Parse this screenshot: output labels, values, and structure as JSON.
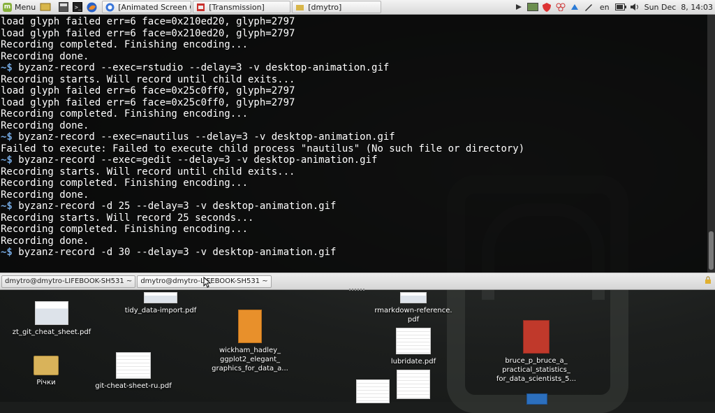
{
  "top_panel": {
    "menu_label": "Menu",
    "windows": [
      {
        "title": "[Animated Screen Ca..."
      },
      {
        "title": "[Transmission]"
      },
      {
        "title": "[dmytro]"
      }
    ],
    "keyboard_layout": "en",
    "clock": "Sun Dec  8, 14:03"
  },
  "terminal": {
    "lines": [
      {
        "prompt": "",
        "text": "load glyph failed err=6 face=0x210ed20, glyph=2797"
      },
      {
        "prompt": "",
        "text": "load glyph failed err=6 face=0x210ed20, glyph=2797"
      },
      {
        "prompt": "",
        "text": "Recording completed. Finishing encoding..."
      },
      {
        "prompt": "",
        "text": "Recording done."
      },
      {
        "prompt": "~$",
        "text": " byzanz-record --exec=rstudio --delay=3 -v desktop-animation.gif"
      },
      {
        "prompt": "",
        "text": "Recording starts. Will record until child exits..."
      },
      {
        "prompt": "",
        "text": "load glyph failed err=6 face=0x25c0ff0, glyph=2797"
      },
      {
        "prompt": "",
        "text": "load glyph failed err=6 face=0x25c0ff0, glyph=2797"
      },
      {
        "prompt": "",
        "text": "Recording completed. Finishing encoding..."
      },
      {
        "prompt": "",
        "text": "Recording done."
      },
      {
        "prompt": "~$",
        "text": " byzanz-record --exec=nautilus --delay=3 -v desktop-animation.gif"
      },
      {
        "prompt": "",
        "text": "Failed to execute: Failed to execute child process \"nautilus\" (No such file or directory)"
      },
      {
        "prompt": "~$",
        "text": " byzanz-record --exec=gedit --delay=3 -v desktop-animation.gif"
      },
      {
        "prompt": "",
        "text": "Recording starts. Will record until child exits..."
      },
      {
        "prompt": "",
        "text": "Recording completed. Finishing encoding..."
      },
      {
        "prompt": "",
        "text": "Recording done."
      },
      {
        "prompt": "~$",
        "text": " byzanz-record -d 25 --delay=3 -v desktop-animation.gif"
      },
      {
        "prompt": "",
        "text": "Recording starts. Will record 25 seconds..."
      },
      {
        "prompt": "",
        "text": "Recording completed. Finishing encoding..."
      },
      {
        "prompt": "",
        "text": "Recording done."
      },
      {
        "prompt": "~$",
        "text": " byzanz-record -d 30 --delay=3 -v desktop-animation.gif"
      }
    ],
    "tabs": [
      {
        "label": "dmytro@dmytro-LIFEBOOK-SH531 ~"
      },
      {
        "label": "dmytro@dmytro-LIFEBOOK-SH531 ~"
      }
    ]
  },
  "desktop_icons": {
    "tidy_data_import": "tidy_data-import.pdf",
    "rmarkdown_reference": "rmarkdown-reference.\npdf",
    "zt_git": "zt_git_cheat_sheet.pdf",
    "wickham": "wickham_hadley_\nggplot2_elegant_\ngraphics_for_data_a...",
    "lubridate": "lubridate.pdf",
    "bruce": "bruce_p_bruce_a_\npractical_statistics_\nfor_data_scientists_5...",
    "richky": "Річки",
    "git_cheat_ru": "git-cheat-sheet-ru.pdf"
  }
}
